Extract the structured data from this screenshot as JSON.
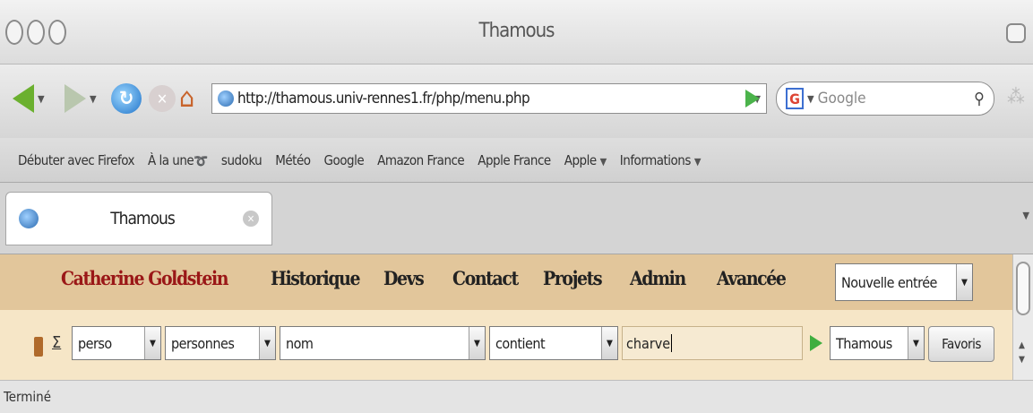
{
  "window": {
    "title": "Thamous"
  },
  "toolbar": {
    "url": "http://thamous.univ-rennes1.fr/php/menu.php",
    "search_placeholder": "Google"
  },
  "bookmarks": [
    "Débuter avec Firefox",
    "À la une",
    "sudoku",
    "Météo",
    "Google",
    "Amazon France",
    "Apple France",
    "Apple",
    "Informations"
  ],
  "tab": {
    "title": "Thamous"
  },
  "menu": {
    "brand": "Catherine Goldstein",
    "items": [
      "Historique",
      "Devs",
      "Contact",
      "Projets",
      "Admin",
      "Avancée"
    ],
    "new_entry": "Nouvelle entrée"
  },
  "search": {
    "scope": "perso",
    "category": "personnes",
    "field": "nom",
    "operator": "contient",
    "query": "charve",
    "target": "Thamous",
    "favoris_label": "Favoris"
  },
  "status": {
    "text": "Terminé"
  },
  "colors": {
    "menu_background": "#e2c69b",
    "brand_text": "#9a1717",
    "search_row_background": "#f6e6c7",
    "go_arrow": "#3fae3f"
  },
  "icons": [
    "back-arrow-icon",
    "forward-arrow-icon",
    "reload-icon",
    "stop-icon",
    "home-icon",
    "globe-icon",
    "google-icon",
    "magnifier-icon",
    "rss-icon",
    "pencil-icon",
    "sigma-icon",
    "play-icon"
  ]
}
